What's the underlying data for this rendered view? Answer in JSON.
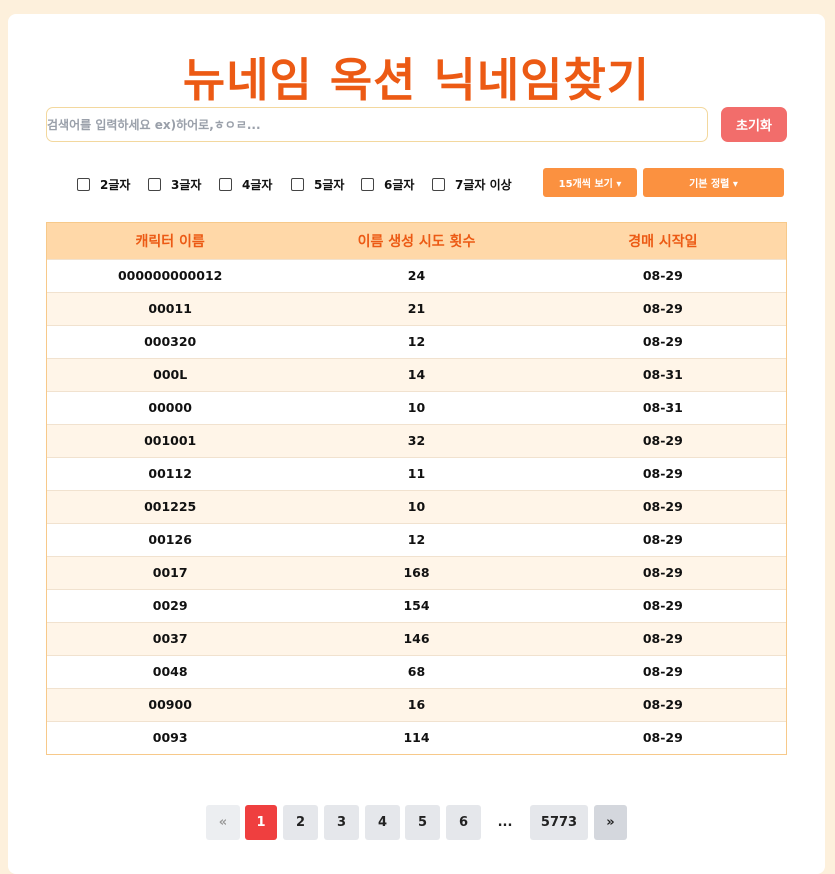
{
  "header": {
    "title": "뉴네임 옥션 닉네임찾기"
  },
  "search": {
    "placeholder": "검색어를 입력하세요 ex)하어로,ㅎㅇㄹ...",
    "value": "",
    "reset_label": "초기화"
  },
  "filters": {
    "length_options": [
      {
        "label": "2글자",
        "checked": false
      },
      {
        "label": "3글자",
        "checked": false
      },
      {
        "label": "4글자",
        "checked": false
      },
      {
        "label": "5글자",
        "checked": false
      },
      {
        "label": "6글자",
        "checked": false
      },
      {
        "label": "7글자 이상",
        "checked": false
      }
    ],
    "page_size_label": "15개씩 보기 ▾",
    "sort_label": "기본 정렬 ▾"
  },
  "table": {
    "columns": [
      "캐릭터 이름",
      "이름 생성 시도 횟수",
      "경매 시작일"
    ],
    "rows": [
      [
        "000000000012",
        "24",
        "08-29"
      ],
      [
        "00011",
        "21",
        "08-29"
      ],
      [
        "000320",
        "12",
        "08-29"
      ],
      [
        "000L",
        "14",
        "08-31"
      ],
      [
        "00000",
        "10",
        "08-31"
      ],
      [
        "001001",
        "32",
        "08-29"
      ],
      [
        "00112",
        "11",
        "08-29"
      ],
      [
        "001225",
        "10",
        "08-29"
      ],
      [
        "00126",
        "12",
        "08-29"
      ],
      [
        "0017",
        "168",
        "08-29"
      ],
      [
        "0029",
        "154",
        "08-29"
      ],
      [
        "0037",
        "146",
        "08-29"
      ],
      [
        "0048",
        "68",
        "08-29"
      ],
      [
        "00900",
        "16",
        "08-29"
      ],
      [
        "0093",
        "114",
        "08-29"
      ]
    ]
  },
  "pagination": {
    "prev": "«",
    "pages": [
      "1",
      "2",
      "3",
      "4",
      "5",
      "6"
    ],
    "ellipsis": "...",
    "last": "5773",
    "next": "»",
    "current": "1"
  },
  "colors": {
    "accent": "#ec5a14",
    "button_orange": "#fb9140",
    "reset_red": "#f26d6b",
    "active_page": "#ef3f3f",
    "header_bg": "#ffd8a8"
  }
}
